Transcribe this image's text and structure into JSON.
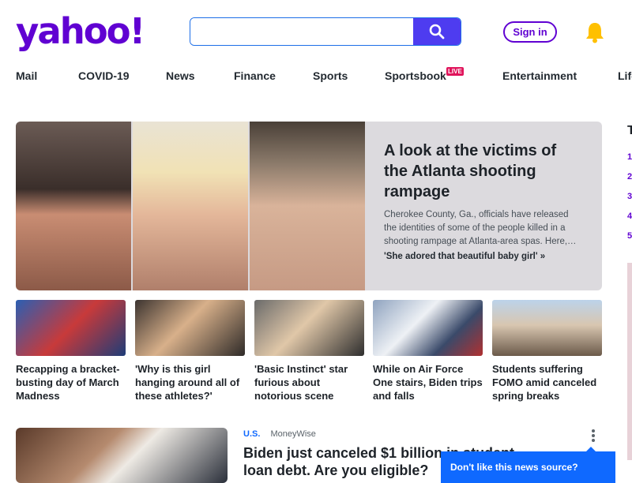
{
  "header": {
    "logo": "yahoo!",
    "search": {
      "value": "",
      "placeholder": ""
    },
    "signin_label": "Sign in"
  },
  "nav": [
    "Mail",
    "COVID-19",
    "News",
    "Finance",
    "Sports",
    "Sportsbook",
    "Entertainment",
    "Life"
  ],
  "nav_live_badge": "LIVE",
  "hero": {
    "title": "A look at the victims of the Atlanta shooting rampage",
    "description": "Cherokee County, Ga., officials have released the identities of some of the people killed in a shooting rampage at Atlanta-area spas. Here,…",
    "link": "'She adored that beautiful baby girl' »"
  },
  "cards": [
    {
      "caption": "Recapping a bracket-busting day of March Madness"
    },
    {
      "caption": "'Why is this girl hanging around all of these athletes?'"
    },
    {
      "caption": "'Basic Instinct' star furious about notorious scene"
    },
    {
      "caption": "While on Air Force One stairs, Biden trips and falls"
    },
    {
      "caption": "Students suffering FOMO amid canceled spring breaks"
    }
  ],
  "story": {
    "category": "U.S.",
    "source": "MoneyWise",
    "title": "Biden just canceled $1 billion in student loan debt. Are you eligible?"
  },
  "tooltip": "Don't like this news source?",
  "trending": {
    "title": "T",
    "numbers": [
      "1",
      "2",
      "3",
      "4",
      "5"
    ]
  },
  "colors": {
    "brand": "#6001d2",
    "search_button": "#4e3cf0",
    "link_blue": "#0f69ff",
    "live_badge": "#e0145b",
    "bell": "#ffc000"
  }
}
